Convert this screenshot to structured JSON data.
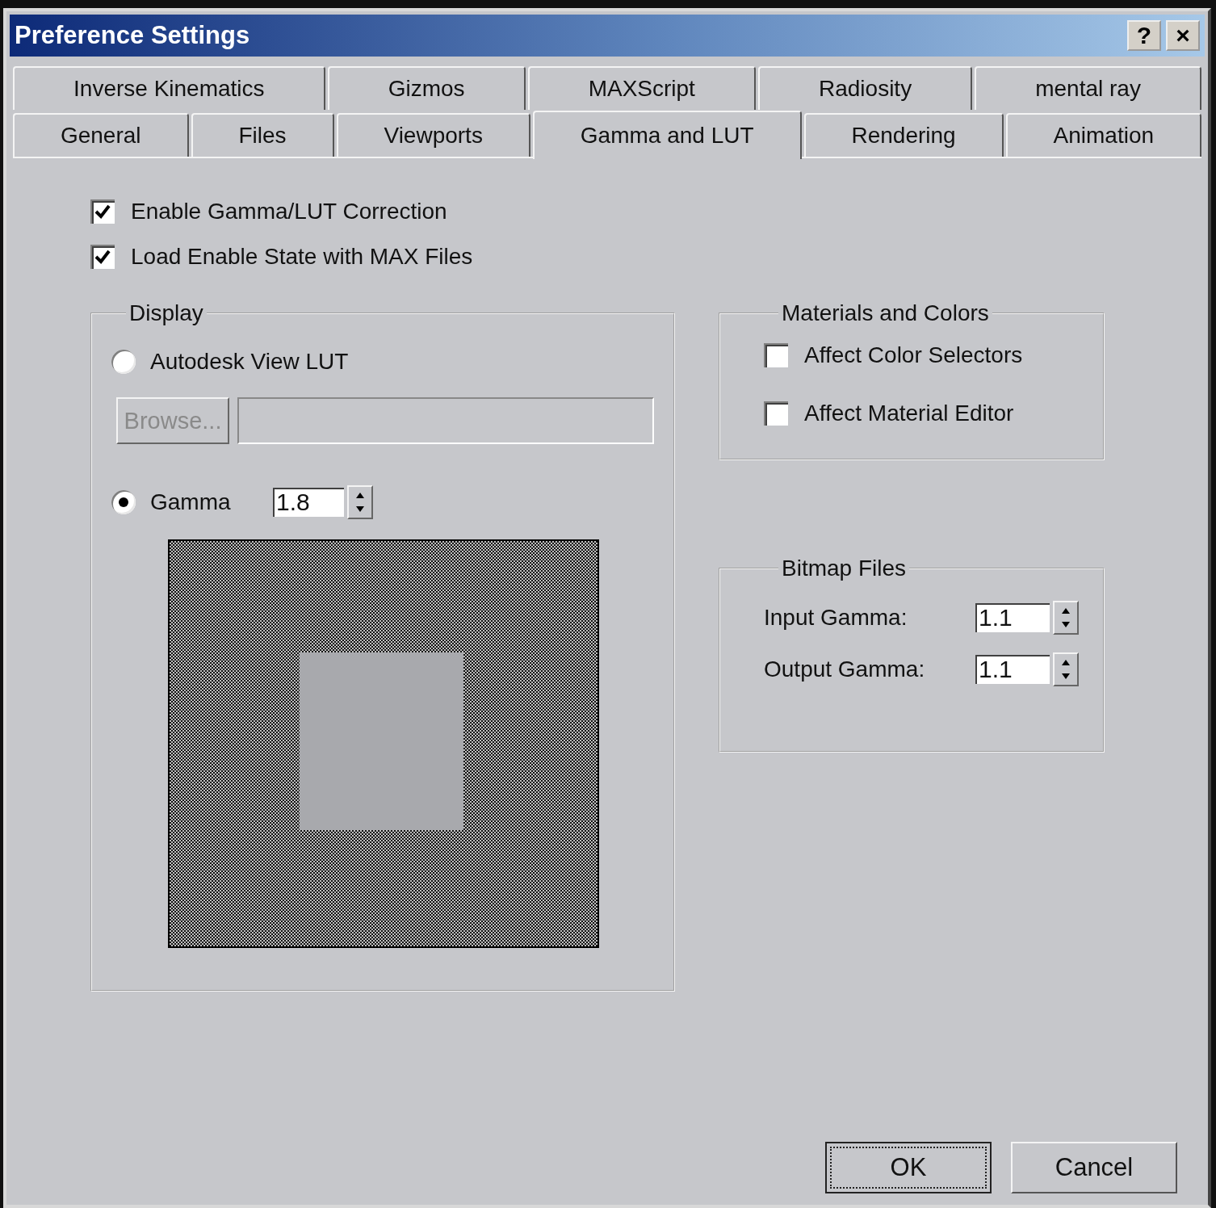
{
  "window": {
    "title": "Preference Settings",
    "buttons": [
      "?",
      "×"
    ]
  },
  "tab_rows": [
    [
      {
        "label": "Inverse Kinematics",
        "selected": false
      },
      {
        "label": "Gizmos",
        "selected": false
      },
      {
        "label": "MAXScript",
        "selected": false
      },
      {
        "label": "Radiosity",
        "selected": false
      },
      {
        "label": "mental ray",
        "selected": false
      }
    ],
    [
      {
        "label": "General",
        "selected": false
      },
      {
        "label": "Files",
        "selected": false
      },
      {
        "label": "Viewports",
        "selected": false
      },
      {
        "label": "Gamma and LUT",
        "selected": true
      },
      {
        "label": "Rendering",
        "selected": false
      },
      {
        "label": "Animation",
        "selected": false
      }
    ]
  ],
  "options": [
    {
      "label": "Enable Gamma/LUT Correction",
      "checked": true
    },
    {
      "label": "Load Enable State with MAX Files",
      "checked": true
    }
  ],
  "display": {
    "title": "Display",
    "modes": [
      {
        "label": "Autodesk View LUT",
        "selected": false
      },
      {
        "label": "Gamma",
        "selected": true
      }
    ],
    "browse_button": {
      "label": "Browse...",
      "disabled": true
    },
    "gamma_value": "1.8"
  },
  "materials_and_colors": {
    "title": "Materials and Colors",
    "checkboxes": [
      {
        "label": "Affect Color Selectors",
        "checked": false
      },
      {
        "label": "Affect Material Editor",
        "checked": false
      }
    ]
  },
  "bitmap_files": {
    "title": "Bitmap Files",
    "fields": [
      {
        "label": "Input Gamma:",
        "value": "1.1"
      },
      {
        "label": "Output Gamma:",
        "value": "1.1"
      }
    ]
  },
  "buttons": [
    {
      "label": "OK",
      "focused": true
    },
    {
      "label": "Cancel",
      "focused": false
    }
  ]
}
